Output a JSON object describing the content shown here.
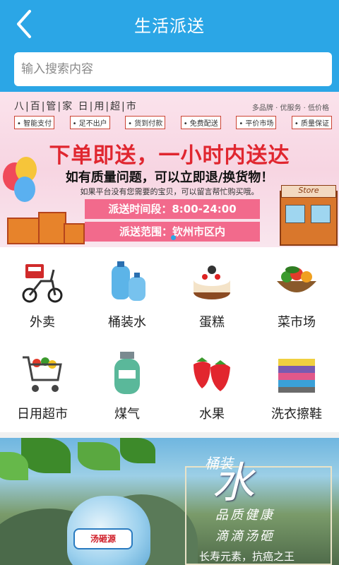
{
  "header": {
    "title": "生活派送",
    "search_placeholder": "输入搜索内容",
    "colors": {
      "header_bg": "#2ba6e6"
    }
  },
  "banner": {
    "brand": "八|百|管|家 日|用|超|市",
    "slogan_right": "多品牌 · 优服务 · 低价格",
    "tags": [
      "• 智能支付",
      "• 足不出户",
      "• 货到付款",
      "• 免费配送",
      "• 平价市场",
      "• 质量保证"
    ],
    "headline": "下单即送，一小时内送达",
    "subheadline": "如有质量问题，可以立即退/换货物！",
    "note": "如果平台没有您需要的宝贝，可以留言帮忙购买哦。",
    "time": "派送时间段：8:00-24:00",
    "range": "派送范围：钦州市区内",
    "store_sign": "Store"
  },
  "categories": [
    {
      "label": "外卖",
      "icon": "delivery-scooter-icon"
    },
    {
      "label": "桶装水",
      "icon": "water-bottle-icon"
    },
    {
      "label": "蛋糕",
      "icon": "cake-icon"
    },
    {
      "label": "菜市场",
      "icon": "vegetable-basket-icon"
    },
    {
      "label": "日用超市",
      "icon": "shopping-cart-icon"
    },
    {
      "label": "煤气",
      "icon": "gas-cylinder-icon"
    },
    {
      "label": "水果",
      "icon": "strawberry-icon"
    },
    {
      "label": "洗衣擦鞋",
      "icon": "folded-clothes-icon"
    }
  ],
  "promo": {
    "tong": "桶装",
    "water": "水",
    "line1": "品质健康",
    "line2": "滴滴汤砸",
    "line3": "长寿元素，抗癌之王",
    "bottle_label": "汤砸源"
  }
}
